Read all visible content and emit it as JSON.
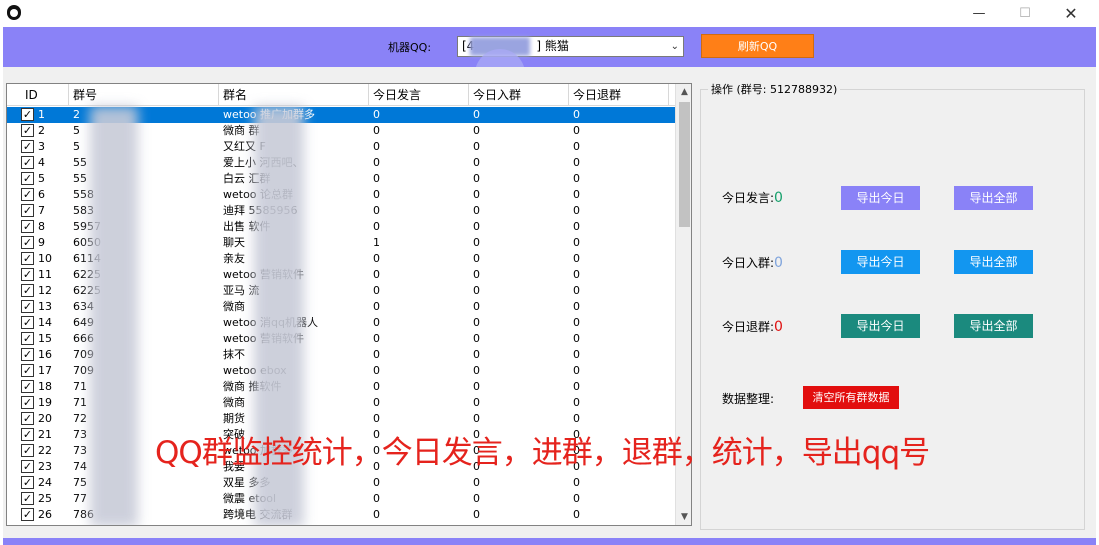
{
  "titlebar": {
    "min": "—",
    "max": "☐",
    "close": "✕"
  },
  "topbar": {
    "robot_label": "机器QQ:",
    "robot_value_prefix": "[4",
    "robot_value_suffix": "] 熊猫",
    "refresh_label": "刷新QQ"
  },
  "grid": {
    "columns": [
      "ID",
      "群号",
      "群名",
      "今日发言",
      "今日入群",
      "今日退群"
    ],
    "rows": [
      {
        "id": "1",
        "gid": "2",
        "name": "wetoo 推广加群多",
        "msg": "0",
        "in": "0",
        "out": "0"
      },
      {
        "id": "2",
        "gid": "5",
        "name": "微商 群",
        "msg": "0",
        "in": "0",
        "out": "0"
      },
      {
        "id": "3",
        "gid": "5",
        "name": "又红又 F",
        "msg": "0",
        "in": "0",
        "out": "0"
      },
      {
        "id": "4",
        "gid": "55",
        "name": "爱上小 河西吧、",
        "msg": "0",
        "in": "0",
        "out": "0"
      },
      {
        "id": "5",
        "gid": "55",
        "name": "白云 汇群",
        "msg": "0",
        "in": "0",
        "out": "0"
      },
      {
        "id": "6",
        "gid": "558",
        "name": "wetoo 论总群",
        "msg": "0",
        "in": "0",
        "out": "0"
      },
      {
        "id": "7",
        "gid": "583",
        "name": "迪拜 5585956",
        "msg": "0",
        "in": "0",
        "out": "0"
      },
      {
        "id": "8",
        "gid": "5957",
        "name": "出售 软件",
        "msg": "0",
        "in": "0",
        "out": "0"
      },
      {
        "id": "9",
        "gid": "6050",
        "name": "聊天",
        "msg": "1",
        "in": "0",
        "out": "0"
      },
      {
        "id": "10",
        "gid": "6114",
        "name": "亲友",
        "msg": "0",
        "in": "0",
        "out": "0"
      },
      {
        "id": "11",
        "gid": "6225",
        "name": "wetoo 营销软件",
        "msg": "0",
        "in": "0",
        "out": "0"
      },
      {
        "id": "12",
        "gid": "6225",
        "name": "亚马 流",
        "msg": "0",
        "in": "0",
        "out": "0"
      },
      {
        "id": "13",
        "gid": "634",
        "name": "微商",
        "msg": "0",
        "in": "0",
        "out": "0"
      },
      {
        "id": "14",
        "gid": "649",
        "name": "wetoo 消qq机器人",
        "msg": "0",
        "in": "0",
        "out": "0"
      },
      {
        "id": "15",
        "gid": "666",
        "name": "wetoo 营销软件",
        "msg": "0",
        "in": "0",
        "out": "0"
      },
      {
        "id": "16",
        "gid": "709",
        "name": "抹不",
        "msg": "0",
        "in": "0",
        "out": "0"
      },
      {
        "id": "17",
        "gid": "709",
        "name": "wetoo ebox",
        "msg": "0",
        "in": "0",
        "out": "0"
      },
      {
        "id": "18",
        "gid": "71",
        "name": "微商 推软件",
        "msg": "0",
        "in": "0",
        "out": "0"
      },
      {
        "id": "19",
        "gid": "71",
        "name": "微商",
        "msg": "0",
        "in": "0",
        "out": "0"
      },
      {
        "id": "20",
        "gid": "72",
        "name": "期货",
        "msg": "0",
        "in": "0",
        "out": "0"
      },
      {
        "id": "21",
        "gid": "73",
        "name": "突破",
        "msg": "0",
        "in": "0",
        "out": "0"
      },
      {
        "id": "22",
        "gid": "73",
        "name": "wetoo 加群多",
        "msg": "0",
        "in": "0",
        "out": "0"
      },
      {
        "id": "23",
        "gid": "74",
        "name": "我要",
        "msg": "0",
        "in": "0",
        "out": "0"
      },
      {
        "id": "24",
        "gid": "75",
        "name": "双星 多多",
        "msg": "0",
        "in": "0",
        "out": "0"
      },
      {
        "id": "25",
        "gid": "77",
        "name": "微震 etool",
        "msg": "0",
        "in": "0",
        "out": "0"
      },
      {
        "id": "26",
        "gid": "786",
        "name": "跨境电 交流群",
        "msg": "0",
        "in": "0",
        "out": "0"
      }
    ]
  },
  "ops": {
    "title": "操作 (群号: 512788932)",
    "msg_label": "今日发言:",
    "msg_value": "0",
    "in_label": "今日入群:",
    "in_value": "0",
    "out_label": "今日退群:",
    "out_value": "0",
    "export_today": "导出今日",
    "export_all": "导出全部",
    "data_label": "数据整理:",
    "clear_label": "清空所有群数据"
  },
  "overlay": "QQ群监控统计，今日发言，进群，退群，统计，导出qq号",
  "colors": {
    "accent": "#8a82f7",
    "refresh": "#ff7f17",
    "selected_row": "#0078d7",
    "blue_btn": "#1296f0",
    "teal_btn": "#1b8a7e",
    "red_btn": "#e20e0e",
    "overlay_text": "#e5231d"
  }
}
